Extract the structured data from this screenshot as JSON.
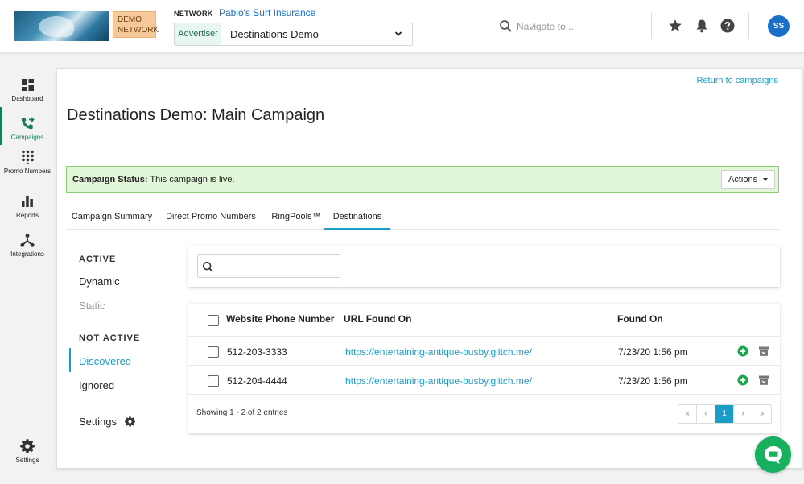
{
  "header": {
    "demo_badge": "DEMO NETWORK",
    "network_tag": "NETWORK",
    "network_name": "Pablo's Surf Insurance",
    "advertiser_tag": "Advertiser",
    "advertiser_value": "Destinations Demo",
    "search_placeholder": "Navigate to...",
    "avatar_initials": "SS"
  },
  "sidebar": {
    "items": [
      {
        "label": "Dashboard",
        "icon": "dashboard-icon"
      },
      {
        "label": "Campaigns",
        "icon": "phone-forward-icon"
      },
      {
        "label": "Promo Numbers",
        "icon": "keypad-icon"
      },
      {
        "label": "Reports",
        "icon": "bar-chart-icon"
      },
      {
        "label": "Integrations",
        "icon": "network-icon"
      },
      {
        "label": "Settings",
        "icon": "gear-icon"
      }
    ],
    "active": "Campaigns"
  },
  "main": {
    "return_link": "Return to campaigns",
    "title": "Destinations Demo: Main Campaign",
    "status_label": "Campaign Status:",
    "status_text": "This campaign is live.",
    "actions_label": "Actions",
    "tabs": [
      {
        "label": "Campaign Summary"
      },
      {
        "label": "Direct Promo Numbers"
      },
      {
        "label": "RingPools™"
      },
      {
        "label": "Destinations"
      }
    ],
    "active_tab": "Destinations"
  },
  "subnav": {
    "active_heading": "ACTIVE",
    "dynamic": "Dynamic",
    "static": "Static",
    "inactive_heading": "NOT ACTIVE",
    "discovered": "Discovered",
    "ignored": "Ignored",
    "settings": "Settings"
  },
  "table": {
    "search_value": "",
    "columns": [
      "Website Phone Number",
      "URL Found On",
      "Found On"
    ],
    "rows": [
      {
        "phone": "512-203-3333",
        "url": "https://entertaining-antique-busby.glitch.me/",
        "found_on": "7/23/20 1:56 pm"
      },
      {
        "phone": "512-204-4444",
        "url": "https://entertaining-antique-busby.glitch.me/",
        "found_on": "7/23/20 1:56 pm"
      }
    ],
    "showing": "Showing 1 - 2 of 2 entries",
    "pagination": [
      "«",
      "‹",
      "1",
      "›",
      "»"
    ],
    "current_page": "1"
  },
  "colors": {
    "accent": "#1a9dc7",
    "sidebar_active": "#1b7a5f",
    "status_bg": "#e2f7d8",
    "status_border": "#8bcd74",
    "chat": "#17b05f",
    "add_action": "#1aa64b"
  }
}
